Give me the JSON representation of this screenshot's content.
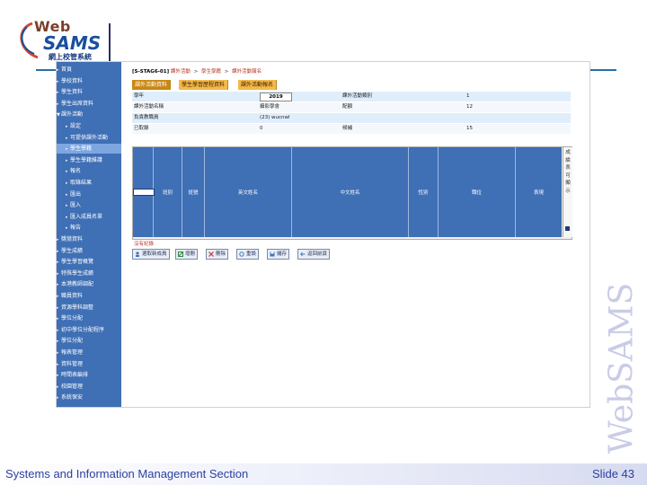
{
  "logo": {
    "web": "Web",
    "sams": "SAMS",
    "subtitle": "網上校管系統"
  },
  "watermark": "WebSAMS",
  "footer": {
    "left": "Systems and Information Management Section",
    "right": "Slide 43"
  },
  "sidebar": {
    "items": [
      {
        "label": "首頁",
        "level": 0
      },
      {
        "label": "學校資料",
        "level": 0
      },
      {
        "label": "學生資料",
        "level": 0
      },
      {
        "label": "學生出席資料",
        "level": 0
      },
      {
        "label": "課外活動",
        "level": 0,
        "open": true
      },
      {
        "label": "設定",
        "level": 1
      },
      {
        "label": "可提供課外活動",
        "level": 1
      },
      {
        "label": "學生學籍",
        "level": 1,
        "active": true
      },
      {
        "label": "學生學籍維護",
        "level": 1
      },
      {
        "label": "報名",
        "level": 1
      },
      {
        "label": "取錄結果",
        "level": 1
      },
      {
        "label": "匯出",
        "level": 1
      },
      {
        "label": "匯入",
        "level": 1
      },
      {
        "label": "匯入成員名單",
        "level": 1
      },
      {
        "label": "報告",
        "level": 1
      },
      {
        "label": "獎懲資料",
        "level": 0
      },
      {
        "label": "學生成績",
        "level": 0
      },
      {
        "label": "學生學習概覽",
        "level": 0
      },
      {
        "label": "特殊學生成績",
        "level": 0
      },
      {
        "label": "本港教師調配",
        "level": 0
      },
      {
        "label": "職員資料",
        "level": 0
      },
      {
        "label": "資源學科調整",
        "level": 0
      },
      {
        "label": "學位分配",
        "level": 0
      },
      {
        "label": "初中學位分配程序",
        "level": 0
      },
      {
        "label": "學位分配",
        "level": 0
      },
      {
        "label": "報表管理",
        "level": 0
      },
      {
        "label": "資料管理",
        "level": 0
      },
      {
        "label": "時間表編排",
        "level": 0
      },
      {
        "label": "校園管理",
        "level": 0
      },
      {
        "label": "系統保安",
        "level": 0
      }
    ]
  },
  "breadcrumb": {
    "code": "[S-STAG6-01]",
    "links": [
      "課外活動",
      "學生學籍",
      "課外活動報名"
    ]
  },
  "tabs": [
    {
      "label": "課外活動資料",
      "current": true
    },
    {
      "label": "學生學習歷程資料",
      "current": false
    },
    {
      "label": "課外活動報名",
      "current": false
    }
  ],
  "info": {
    "row1": {
      "label1": "學年",
      "value1": "2019",
      "label2": "課外活動類別",
      "value2": "1"
    },
    "row2": {
      "label1": "課外活動名稱",
      "value1": "攝影學會",
      "label2": "配額",
      "value2": "12"
    },
    "row3": {
      "label1": "負責教職員",
      "value1": "(23) wucnwl",
      "label2": "",
      "value2": ""
    },
    "row4": {
      "label1": "已取錄",
      "value1": "0",
      "label2": "候補",
      "value2": "15"
    }
  },
  "table": {
    "columns": [
      "班別",
      "班號",
      "英文姓名",
      "中文姓名",
      "性別",
      "職位",
      "表現"
    ],
    "side_label": "成績表可顯示",
    "empty_text": "沒有紀錄"
  },
  "buttons": [
    {
      "label": "選取新成員",
      "icon": "add-member-icon"
    },
    {
      "label": "增刪",
      "icon": "edit-icon"
    },
    {
      "label": "刪除",
      "icon": "delete-icon"
    },
    {
      "label": "重設",
      "icon": "reset-icon"
    },
    {
      "label": "儲存",
      "icon": "save-icon"
    },
    {
      "label": "返回前頁",
      "icon": "back-icon"
    }
  ]
}
